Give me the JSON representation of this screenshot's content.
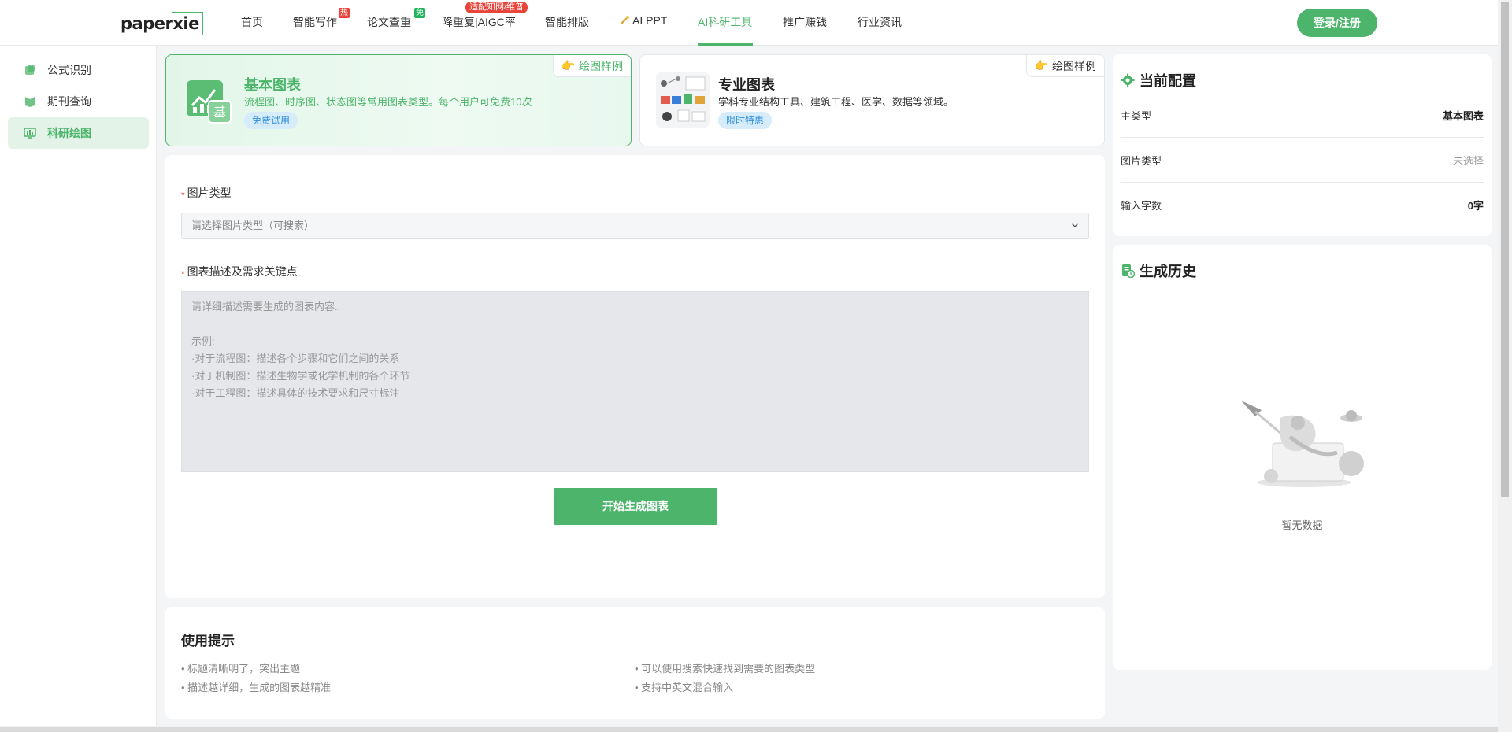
{
  "nav": {
    "logo": "paperxie",
    "logo_part1": "paper",
    "logo_part2": "xie",
    "items": [
      "首页",
      "智能写作",
      "论文查重",
      "降重复|AIGC率",
      "智能排版",
      "AI PPT",
      "AI科研工具",
      "推广赚钱",
      "行业资讯"
    ],
    "badge_hot": "热",
    "badge_free": "免",
    "badge_adapt": "适配知网/维普",
    "login": "登录/注册"
  },
  "sidebar": {
    "items": [
      {
        "label": "公式识别",
        "icon": "formula-icon"
      },
      {
        "label": "期刊查询",
        "icon": "journal-icon"
      },
      {
        "label": "科研绘图",
        "icon": "chart-draw-icon",
        "active": true
      }
    ]
  },
  "cards": {
    "basic": {
      "title": "基本图表",
      "desc": "流程图、时序图、状态图等常用图表类型。每个用户可免费10次",
      "tag": "免费试用",
      "sample": "绘图样例",
      "icon_char": "基"
    },
    "pro": {
      "title": "专业图表",
      "desc": "学科专业结构工具、建筑工程、医学、数据等领域。",
      "tag": "限时特惠",
      "sample": "绘图样例"
    }
  },
  "form": {
    "type_label": "图片类型",
    "type_placeholder": "请选择图片类型（可搜索）",
    "desc_label": "图表描述及需求关键点",
    "desc_placeholder": "请详细描述需要生成的图表内容..\n\n示例:\n·对于流程图：描述各个步骤和它们之间的关系\n·对于机制图：描述生物学或化学机制的各个环节\n·对于工程图：描述具体的技术要求和尺寸标注",
    "submit": "开始生成图表"
  },
  "tips": {
    "title": "使用提示",
    "items": [
      "• 标题清晰明了，突出主题",
      "• 可以使用搜索快速找到需要的图表类型",
      "• 描述越详细，生成的图表越精准",
      "• 支持中英文混合输入"
    ]
  },
  "config": {
    "title": "当前配置",
    "rows": [
      {
        "key": "主类型",
        "value": "基本图表"
      },
      {
        "key": "图片类型",
        "value": "未选择"
      },
      {
        "key": "输入字数",
        "value": "0字"
      }
    ]
  },
  "history": {
    "title": "生成历史",
    "empty": "暂无数据"
  },
  "colors": {
    "accent": "#4cb56b",
    "badge_red": "#e8443a",
    "tag_blue": "#2f8fd9"
  }
}
